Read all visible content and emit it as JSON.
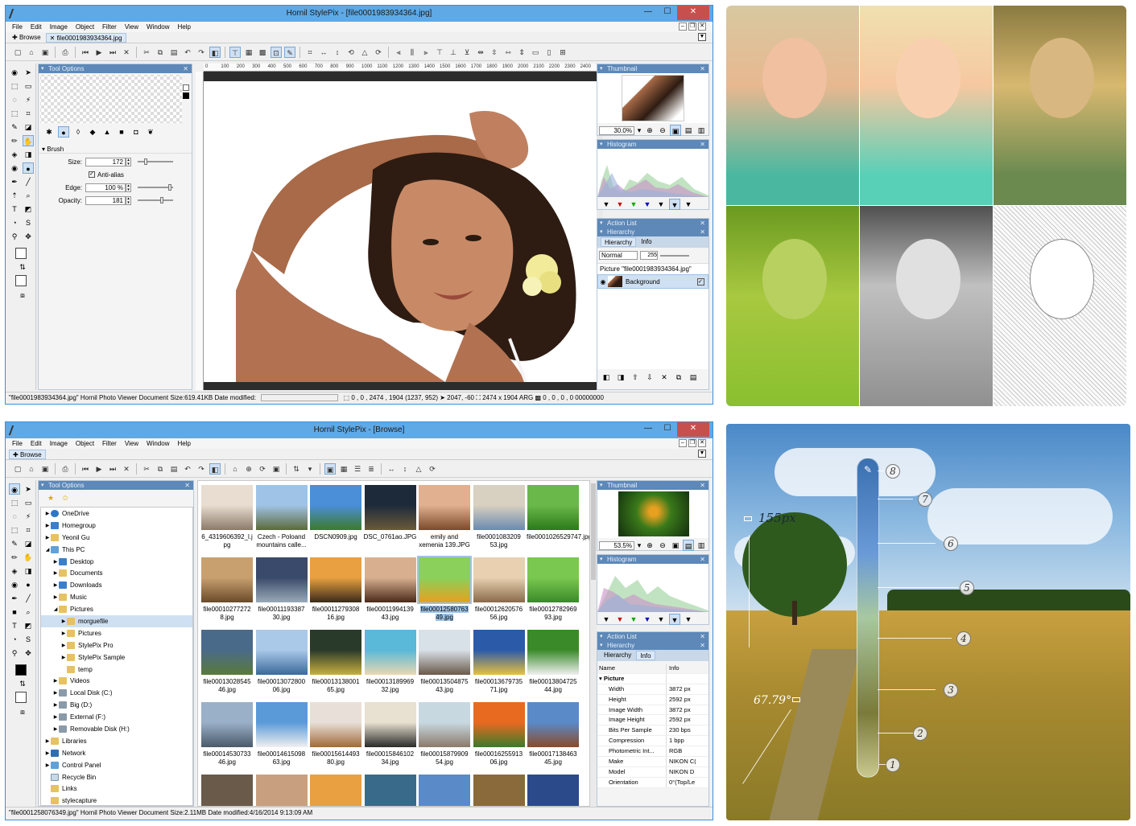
{
  "top": {
    "app_title": "Hornil StylePix - [file0001983934364.jpg]",
    "menu": [
      "File",
      "Edit",
      "Image",
      "Object",
      "Filter",
      "View",
      "Window",
      "Help"
    ],
    "tabs": [
      "Browse",
      "file0001983934364.jpg"
    ],
    "tool_options_title": "Tool Options",
    "brush_title": "Brush",
    "brush": {
      "size_label": "Size:",
      "size_value": "172",
      "antialias_label": "Anti-alias",
      "edge_label": "Edge:",
      "edge_value": "100 %",
      "opacity_label": "Opacity:",
      "opacity_value": "181"
    },
    "ruler_ticks": [
      "0",
      "100",
      "200",
      "300",
      "400",
      "500",
      "600",
      "700",
      "800",
      "900",
      "1000",
      "1100",
      "1200",
      "1300",
      "1400",
      "1500",
      "1600",
      "1700",
      "1800",
      "1900",
      "2000",
      "2100",
      "2200",
      "2300",
      "2400"
    ],
    "thumbnail_title": "Thumbnail",
    "zoom_value": "30.0%",
    "histogram_title": "Histogram",
    "action_list_title": "Action List",
    "hierarchy_title": "Hierarchy",
    "hier_tabs": [
      "Hierarchy",
      "Info"
    ],
    "blend_mode": "Normal",
    "opacity_num": "255",
    "picture_label": "Picture \"file0001983934364.jpg\"",
    "layer_name": "Background",
    "status": {
      "doc": "\"file0001983934364.jpg\" Hornil Photo Viewer Document Size:619.41KB Date modified:",
      "sel_start": "0 , 0",
      "sel_info": ", 2474 , 1904  (1237, 952)",
      "cursor": "2047, -60",
      "size": "2474 x 1904 ARG",
      "color": "0 , 0 , 0 , 0",
      "hex": "00000000"
    }
  },
  "bottom": {
    "app_title": "Hornil StylePix - [Browse]",
    "menu": [
      "File",
      "Edit",
      "Image",
      "Object",
      "Filter",
      "View",
      "Window",
      "Help"
    ],
    "tabs": [
      "Browse"
    ],
    "tool_options_title": "Tool Options",
    "tree": [
      {
        "label": "OneDrive",
        "level": 0,
        "exp": "▶",
        "icon": "cloud"
      },
      {
        "label": "Homegroup",
        "level": 0,
        "exp": "▶",
        "icon": "blue"
      },
      {
        "label": "Yeonil Gu",
        "level": 0,
        "exp": "▶",
        "icon": "folder"
      },
      {
        "label": "This PC",
        "level": 0,
        "exp": "◢",
        "icon": "pc"
      },
      {
        "label": "Desktop",
        "level": 1,
        "exp": "▶",
        "icon": "blue"
      },
      {
        "label": "Documents",
        "level": 1,
        "exp": "▶",
        "icon": "folder"
      },
      {
        "label": "Downloads",
        "level": 1,
        "exp": "▶",
        "icon": "blue"
      },
      {
        "label": "Music",
        "level": 1,
        "exp": "▶",
        "icon": "folder"
      },
      {
        "label": "Pictures",
        "level": 1,
        "exp": "◢",
        "icon": "folder"
      },
      {
        "label": "morguefile",
        "level": 2,
        "exp": "▶",
        "icon": "folder",
        "sel": true
      },
      {
        "label": "Pictures",
        "level": 2,
        "exp": "▶",
        "icon": "folder"
      },
      {
        "label": "StylePix Pro",
        "level": 2,
        "exp": "▶",
        "icon": "folder"
      },
      {
        "label": "StylePix Sample",
        "level": 2,
        "exp": "▶",
        "icon": "folder"
      },
      {
        "label": "temp",
        "level": 2,
        "exp": "",
        "icon": "folder"
      },
      {
        "label": "Videos",
        "level": 1,
        "exp": "▶",
        "icon": "folder"
      },
      {
        "label": "Local Disk (C:)",
        "level": 1,
        "exp": "▶",
        "icon": "drive"
      },
      {
        "label": "Big (D:)",
        "level": 1,
        "exp": "▶",
        "icon": "drive"
      },
      {
        "label": "External (F:)",
        "level": 1,
        "exp": "▶",
        "icon": "drive"
      },
      {
        "label": "Removable Disk (H:)",
        "level": 1,
        "exp": "▶",
        "icon": "drive"
      },
      {
        "label": "Libraries",
        "level": 0,
        "exp": "▶",
        "icon": "folder"
      },
      {
        "label": "Network",
        "level": 0,
        "exp": "▶",
        "icon": "net"
      },
      {
        "label": "Control Panel",
        "level": 0,
        "exp": "▶",
        "icon": "pc"
      },
      {
        "label": "Recycle Bin",
        "level": 0,
        "exp": "",
        "icon": "bin"
      },
      {
        "label": "Links",
        "level": 0,
        "exp": "",
        "icon": "folder"
      },
      {
        "label": "stylecapture",
        "level": 0,
        "exp": "",
        "icon": "folder"
      }
    ],
    "thumbs": [
      {
        "name": "6_4319606392_l.j\npg",
        "c1": "#e8ddd0",
        "c2": "#8b7a6a"
      },
      {
        "name": "Czech - Poloand\nmountains calle...",
        "c1": "#9fc3e6",
        "c2": "#5b6a3a"
      },
      {
        "name": "DSCN0909.jpg",
        "c1": "#4a8fd8",
        "c2": "#3d7a2a"
      },
      {
        "name": "DSC_0761ao.JPG",
        "c1": "#1d2a3a",
        "c2": "#6a5a3a"
      },
      {
        "name": "emily and\nxemenia 139.JPG",
        "c1": "#e0b090",
        "c2": "#7a4a2a"
      },
      {
        "name": "file0001083209\n53.jpg",
        "c1": "#d8d0c0",
        "c2": "#6a8ab0"
      },
      {
        "name": "file0001026529747.jpg",
        "c1": "#6ab84a",
        "c2": "#2a7a1a"
      },
      {
        "name": "file00010277272\n8.jpg",
        "c1": "#c8a070",
        "c2": "#6a4a2a"
      },
      {
        "name": "file00011193387\n30.jpg",
        "c1": "#3a4a6a",
        "c2": "#9aaab8"
      },
      {
        "name": "file00011279308\n16.jpg",
        "c1": "#e8a040",
        "c2": "#3a2a1a"
      },
      {
        "name": "file00011994139\n43.jpg",
        "c1": "#d8b090",
        "c2": "#4a2a1a"
      },
      {
        "name": "file00012580763\n49.jpg",
        "c1": "#8ad05a",
        "c2": "#e8a020"
      },
      {
        "name": "file00012620576\n56.jpg",
        "c1": "#e8d0b0",
        "c2": "#8a6a4a"
      },
      {
        "name": "file00012782969\n93.jpg",
        "c1": "#7ac850",
        "c2": "#3a8a2a"
      },
      {
        "name": "file00013028545\n46.jpg",
        "c1": "#4a6a8a",
        "c2": "#5a7a3a"
      },
      {
        "name": "file00013072800\n06.jpg",
        "c1": "#aac8e8",
        "c2": "#3a6a9a"
      },
      {
        "name": "file00013138001\n65.jpg",
        "c1": "#2a3a2a",
        "c2": "#c8b040"
      },
      {
        "name": "file00013189969\n32.jpg",
        "c1": "#5ab8d8",
        "c2": "#e8d8b0"
      },
      {
        "name": "file00013504875\n43.jpg",
        "c1": "#d8e0e8",
        "c2": "#6a5a4a"
      },
      {
        "name": "file00013679735\n71.jpg",
        "c1": "#2a5aa8",
        "c2": "#e8c040"
      },
      {
        "name": "file00013804725\n44.jpg",
        "c1": "#3a8a2a",
        "c2": "#f0f0f0"
      },
      {
        "name": "file00014530733\n46.jpg",
        "c1": "#9ab0c8",
        "c2": "#4a5a6a"
      },
      {
        "name": "file00014615098\n63.jpg",
        "c1": "#5a9ad8",
        "c2": "#f0f0f0"
      },
      {
        "name": "file00015614493\n80.jpg",
        "c1": "#e8e0d8",
        "c2": "#a06a3a"
      },
      {
        "name": "file00015846102\n34.jpg",
        "c1": "#e8e0d0",
        "c2": "#2a2a2a"
      },
      {
        "name": "file00015879909\n54.jpg",
        "c1": "#c8d8e0",
        "c2": "#8a7a6a"
      },
      {
        "name": "file00016255913\n06.jpg",
        "c1": "#e86a20",
        "c2": "#3a7a2a"
      },
      {
        "name": "file00017138463\n45.jpg",
        "c1": "#5a8ac8",
        "c2": "#8a4a2a"
      }
    ],
    "thumbnail_title": "Thumbnail",
    "zoom_value": "53.5%",
    "histogram_title": "Histogram",
    "action_list_title": "Action List",
    "hierarchy_title": "Hierarchy",
    "hier_tabs": [
      "Hierarchy",
      "Info"
    ],
    "info_header": [
      "Name",
      "Info"
    ],
    "info_group": "Picture",
    "info_rows": [
      [
        "Width",
        "3872 px"
      ],
      [
        "Height",
        "2592 px"
      ],
      [
        "Image Width",
        "3872 px"
      ],
      [
        "Image Height",
        "2592 px"
      ],
      [
        "Bits Per Sample",
        "230 bps"
      ],
      [
        "Compression",
        "1 bpp"
      ],
      [
        "Photometric Int...",
        "RGB"
      ],
      [
        "Make",
        "NIKON C("
      ],
      [
        "Model",
        "NIKON D"
      ],
      [
        "Orientation",
        "0°(Top/Le"
      ]
    ],
    "status": "\"file0001258076349.jpg\" Hornil Photo Viewer Document Size:2.11MB Date modified:4/16/2014 9:13:09 AM"
  },
  "measure": {
    "length_label": "155px",
    "angle_label": "67.79°",
    "badges": [
      "8",
      "7",
      "6",
      "5",
      "4",
      "3",
      "2",
      "1"
    ]
  },
  "colors": {
    "title_bar": "#5ea9e6",
    "panel_header": "#5d88b8",
    "selection": "#cfe0f3"
  }
}
